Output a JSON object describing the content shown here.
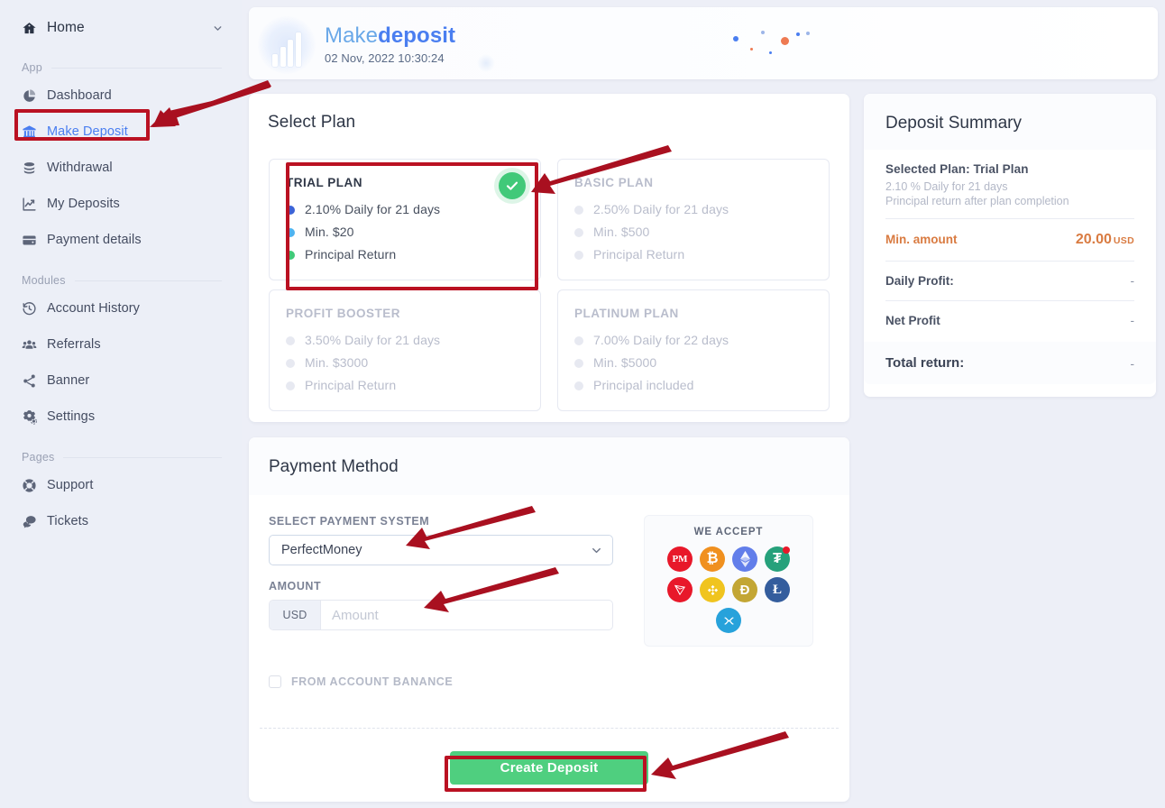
{
  "sidebar": {
    "home": {
      "label": "Home",
      "icon": "home-icon",
      "chevron": "chevron-down-icon"
    },
    "sections": [
      {
        "title": "App",
        "items": [
          {
            "label": "Dashboard",
            "icon": "pie-chart-icon",
            "active": false
          },
          {
            "label": "Make Deposit",
            "icon": "bank-icon",
            "active": true
          },
          {
            "label": "Withdrawal",
            "icon": "coins-icon",
            "active": false
          },
          {
            "label": "My Deposits",
            "icon": "chart-line-icon",
            "active": false
          },
          {
            "label": "Payment details",
            "icon": "wallet-icon",
            "active": false
          }
        ]
      },
      {
        "title": "Modules",
        "items": [
          {
            "label": "Account History",
            "icon": "history-icon",
            "active": false
          },
          {
            "label": "Referrals",
            "icon": "users-icon",
            "active": false
          },
          {
            "label": "Banner",
            "icon": "share-icon",
            "active": false
          },
          {
            "label": "Settings",
            "icon": "gears-icon",
            "active": false
          }
        ]
      },
      {
        "title": "Pages",
        "items": [
          {
            "label": "Support",
            "icon": "lifebuoy-icon",
            "active": false
          },
          {
            "label": "Tickets",
            "icon": "chat-icon",
            "active": false
          }
        ]
      }
    ]
  },
  "header": {
    "title_light": "Make",
    "title_bold": "deposit",
    "datetime": "02 Nov, 2022  10:30:24",
    "logo_icon": "bar-chart-logo-icon"
  },
  "select_plan": {
    "heading": "Select Plan",
    "plans": [
      {
        "name": "TRIAL PLAN",
        "selected": true,
        "check_icon": "check-circle-icon",
        "features": [
          {
            "text": "2.10% Daily for 21 days",
            "color": "#3d63d6"
          },
          {
            "text": "Min. $20",
            "color": "#4fb3f0"
          },
          {
            "text": "Principal Return",
            "color": "#41c979"
          }
        ]
      },
      {
        "name": "BASIC PLAN",
        "selected": false,
        "features": [
          {
            "text": "2.50% Daily for 21 days",
            "color": "#e7e9f1"
          },
          {
            "text": "Min. $500",
            "color": "#e7e9f1"
          },
          {
            "text": "Principal Return",
            "color": "#e7e9f1"
          }
        ]
      },
      {
        "name": "PROFIT BOOSTER",
        "selected": false,
        "features": [
          {
            "text": "3.50% Daily for 21 days",
            "color": "#e7e9f1"
          },
          {
            "text": "Min. $3000",
            "color": "#e7e9f1"
          },
          {
            "text": "Principal Return",
            "color": "#e7e9f1"
          }
        ]
      },
      {
        "name": "PLATINUM PLAN",
        "selected": false,
        "features": [
          {
            "text": "7.00% Daily for 22 days",
            "color": "#e7e9f1"
          },
          {
            "text": "Min. $5000",
            "color": "#e7e9f1"
          },
          {
            "text": "Principal included",
            "color": "#e7e9f1"
          }
        ]
      }
    ]
  },
  "deposit_summary": {
    "heading": "Deposit Summary",
    "selected_plan": "Selected Plan: Trial Plan",
    "plan_rate": "2.10 % Daily for 21 days",
    "plan_note": "Principal return after plan completion",
    "rows": [
      {
        "key": "Min. amount",
        "value": "20.00",
        "unit": "USD",
        "accent": "#d97b41"
      },
      {
        "key": "Daily Profit:",
        "value": "-",
        "unit": "",
        "accent": ""
      },
      {
        "key": "Net Profit",
        "value": "-",
        "unit": "",
        "accent": ""
      }
    ],
    "total_key": "Total return:",
    "total_value": "-"
  },
  "payment_method": {
    "heading": "Payment Method",
    "select_label": "SELECT PAYMENT SYSTEM",
    "select_value": "PerfectMoney",
    "select_chevron": "chevron-down-icon",
    "amount_label": "AMOUNT",
    "amount_currency": "USD",
    "amount_value": "",
    "amount_placeholder": "Amount",
    "we_accept_title": "WE ACCEPT",
    "coins": [
      {
        "name": "perfectmoney-icon",
        "glyph": "PM",
        "color": "#e8182a"
      },
      {
        "name": "bitcoin-icon",
        "glyph": "₿",
        "color": "#f0901f"
      },
      {
        "name": "ethereum-icon",
        "glyph": "⬟",
        "color": "#627eea"
      },
      {
        "name": "tether-icon",
        "glyph": "₮",
        "color": "#26a17b"
      },
      {
        "name": "tron-icon",
        "glyph": "▽",
        "color": "#e8182a"
      },
      {
        "name": "binance-icon",
        "glyph": "◇",
        "color": "#f0c41f"
      },
      {
        "name": "dogecoin-icon",
        "glyph": "Ð",
        "color": "#c3a634"
      },
      {
        "name": "litecoin-icon",
        "glyph": "Ł",
        "color": "#345d9d"
      },
      {
        "name": "ripple-icon",
        "glyph": "✕",
        "color": "#27a2db"
      }
    ],
    "from_balance_label": "FROM ACCOUNT BANANCE",
    "from_balance_checked": false,
    "submit_label": "Create Deposit"
  },
  "annotations": {
    "highlight_color": "#ba1122",
    "arrow_color": "#a91020"
  }
}
